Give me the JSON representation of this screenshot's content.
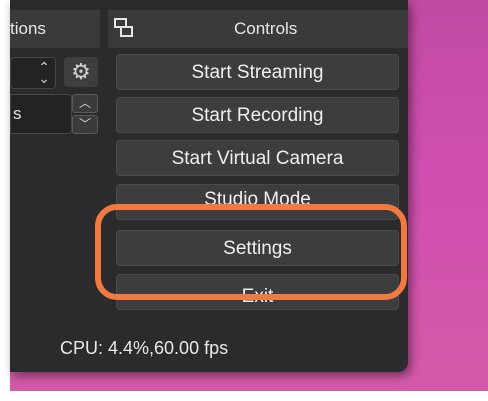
{
  "docks": {
    "left_title": "tions",
    "right_title": "Controls",
    "left_field_text": "s"
  },
  "controls": {
    "start_streaming": "Start Streaming",
    "start_recording": "Start Recording",
    "start_virtual_camera": "Start Virtual Camera",
    "studio_mode": "Studio Mode",
    "settings": "Settings",
    "exit": "Exit"
  },
  "status_bar": {
    "cpu_fps": "CPU: 4.4%,60.00 fps"
  },
  "icons": {
    "undock": "undock-icon",
    "gear": "gear-icon",
    "stepper": "stepper-icon"
  },
  "colors": {
    "annotation_highlight": "#f07a40",
    "window_bg": "#2b2b2d",
    "desktop": "#cf4fb0"
  }
}
